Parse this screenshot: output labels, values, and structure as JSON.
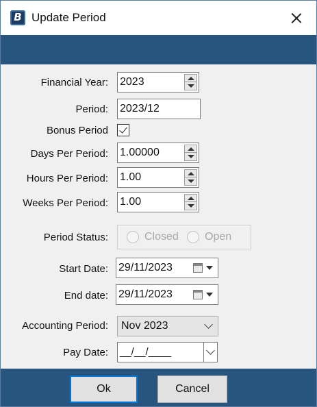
{
  "window": {
    "title": "Update Period"
  },
  "fields": {
    "financial_year": {
      "label": "Financial Year:",
      "value": "2023"
    },
    "period": {
      "label": "Period:",
      "value": "2023/12"
    },
    "bonus_period": {
      "label": "Bonus Period",
      "checked": true
    },
    "days_per_period": {
      "label": "Days Per Period:",
      "value": "1.00000"
    },
    "hours_per_period": {
      "label": "Hours Per Period:",
      "value": "1.00"
    },
    "weeks_per_period": {
      "label": "Weeks Per Period:",
      "value": "1.00"
    },
    "period_status": {
      "label": "Period Status:",
      "options": [
        "Closed",
        "Open"
      ],
      "enabled": false
    },
    "start_date": {
      "label": "Start Date:",
      "value": "29/11/2023"
    },
    "end_date": {
      "label": "End date:",
      "value": "29/11/2023"
    },
    "accounting_period": {
      "label": "Accounting Period:",
      "value": "Nov 2023"
    },
    "pay_date": {
      "label": "Pay Date:",
      "value": "__/__/____"
    }
  },
  "buttons": {
    "ok": "Ok",
    "cancel": "Cancel"
  },
  "colors": {
    "band": "#27557e",
    "focus": "#0078d7"
  }
}
